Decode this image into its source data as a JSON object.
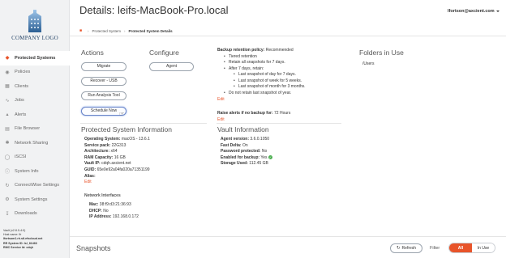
{
  "brand": {
    "logo_text": "COMPANY LOGO",
    "accent": "#e8542a",
    "logo_color": "#2c4a6b"
  },
  "sidebar": {
    "items": [
      {
        "label": "Protected Systems",
        "icon": "shield-icon",
        "active": true
      },
      {
        "label": "Policies",
        "icon": "policy-icon"
      },
      {
        "label": "Clients",
        "icon": "clients-icon"
      },
      {
        "label": "Jobs",
        "icon": "jobs-icon"
      },
      {
        "label": "Alerts",
        "icon": "bell-icon"
      },
      {
        "label": "File Browser",
        "icon": "folder-icon"
      },
      {
        "label": "Network Sharing",
        "icon": "network-icon"
      },
      {
        "label": "iSCSI",
        "icon": "iscsi-icon"
      },
      {
        "label": "System Info",
        "icon": "info-icon"
      },
      {
        "label": "ConnectWise Settings",
        "icon": "connectwise-icon"
      },
      {
        "label": "System Settings",
        "icon": "gear-icon"
      },
      {
        "label": "Downloads",
        "icon": "download-icon"
      }
    ],
    "footer": {
      "version": "Vault (v2.8.0-4:0)",
      "host_label": "Host name: lfr",
      "host_value": "lfortsom1.rh.stl.efscloud.net",
      "rr_label": "RR System ID: lsl_81466",
      "rmc_label": "RMC Service Id: cdqh"
    }
  },
  "header": {
    "title": "Details: leifs-MacBook-Pro.local",
    "user_email": "lfortson@axcient.com",
    "breadcrumb": [
      "Protected System",
      "Protected System Details"
    ]
  },
  "actions": {
    "heading": "Actions",
    "buttons": [
      "Migrate",
      "Recover - USB",
      "Run Analysis Tool",
      "Schedule Now"
    ]
  },
  "configure": {
    "heading": "Configure",
    "agent_button": "Agent"
  },
  "protected_info": {
    "heading": "Protected System Information",
    "fields": [
      {
        "label": "Operating System:",
        "value": "macOS - 13.6.1"
      },
      {
        "label": "Service pack:",
        "value": "22G313"
      },
      {
        "label": "Architecture:",
        "value": "x64"
      },
      {
        "label": "RAM Capacity:",
        "value": "16 GB"
      },
      {
        "label": "Vault IP:",
        "value": "cdqh.axcient.net"
      },
      {
        "label": "GUID:",
        "value": "65e0e92a04fa020a71351199"
      },
      {
        "label": "Alias:",
        "value": ""
      }
    ],
    "edit_label": "Edit",
    "network_heading": "Network Interfaces",
    "network": [
      {
        "label": "Mac:",
        "value": "38:f9:d3:21:36:93"
      },
      {
        "label": "DHCP:",
        "value": "No"
      },
      {
        "label": "IP Address:",
        "value": "192.168.0.172"
      }
    ]
  },
  "retention": {
    "label": "Backup retention policy:",
    "value": "Recommended",
    "items": [
      {
        "text": "Tiered retention",
        "level": 1
      },
      {
        "text": "Retain all snapshots for 7 days.",
        "level": 1
      },
      {
        "text": "After 7 days, retain:",
        "level": 1
      },
      {
        "text": "Last snapshot of day for 7 days.",
        "level": 2
      },
      {
        "text": "Last snapshot of week for 5 weeks.",
        "level": 2
      },
      {
        "text": "Last snapshot of month for 3 months.",
        "level": 2
      },
      {
        "text": "Do not retain last snapshot of year.",
        "level": 1
      }
    ],
    "edit_label": "Edit"
  },
  "alert": {
    "label": "Raise alerts if no backup for:",
    "value": "72 Hours",
    "edit_label": "Edit"
  },
  "vault_info": {
    "heading": "Vault Information",
    "fields": [
      {
        "label": "Agent version:",
        "value": "3.6.0.1050"
      },
      {
        "label": "Fast Delta:",
        "value": "On"
      },
      {
        "label": "Password protected:",
        "value": "No"
      },
      {
        "label": "Enabled for backup:",
        "value": "Yes",
        "icon": "check-icon",
        "icon_color": "#4caf50"
      },
      {
        "label": "Storage Used:",
        "value": "112.45 GB"
      }
    ]
  },
  "folders": {
    "heading": "Folders in Use",
    "path": "/Users"
  },
  "snapshots": {
    "heading": "Snapshots",
    "refresh_label": "Refresh",
    "filter_label": "Filter",
    "filter_options": [
      "All",
      "In Use"
    ],
    "selected_filter": "All"
  }
}
